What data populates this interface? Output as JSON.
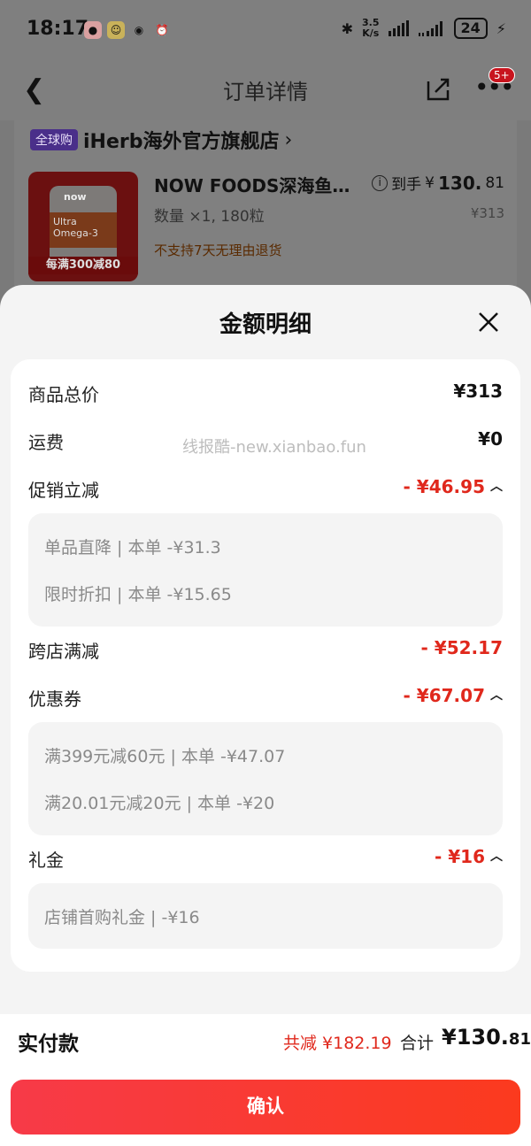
{
  "status_bar": {
    "time": "18:17",
    "net_speed_value": "3.5",
    "net_speed_unit": "K/s",
    "battery": "24"
  },
  "nav": {
    "title": "订单详情",
    "badge": "5+"
  },
  "order": {
    "global_tag": "全球购",
    "store_name": "iHerb海外官方旗舰店",
    "product_name": "NOW FOODS深海鱼…",
    "quantity": "数量 ×1, 180粒",
    "policy": "不支持7天无理由退货",
    "final_price_label": "到手",
    "final_price_currency": "¥",
    "final_price_int": "130.",
    "final_price_dec": "81",
    "original_price": "¥313",
    "image_promo": "每满300减80",
    "image_brand": "now",
    "image_text": "Ultra Omega-3"
  },
  "sheet": {
    "title": "金额明细",
    "rows": {
      "goods_total": {
        "label": "商品总价",
        "value": "¥313"
      },
      "shipping": {
        "label": "运费",
        "value": "¥0"
      },
      "promotion": {
        "label": "促销立减",
        "value": "- ¥46.95"
      },
      "promotion_details": [
        "单品直降 | 本单 -¥31.3",
        "限时折扣 | 本单 -¥15.65"
      ],
      "cross_store": {
        "label": "跨店满减",
        "value": "- ¥52.17"
      },
      "coupon": {
        "label": "优惠券",
        "value": "- ¥67.07"
      },
      "coupon_details": [
        "满399元减60元 | 本单 -¥47.07",
        "满20.01元减20元 | 本单 -¥20"
      ],
      "gift_money": {
        "label": "礼金",
        "value": "- ¥16"
      },
      "gift_details": [
        "店铺首购礼金 | -¥16"
      ]
    },
    "watermark": "线报酷-new.xianbao.fun"
  },
  "summary": {
    "label": "实付款",
    "total_reduce": "共减 ¥182.19",
    "total_label": "合计",
    "total_int": "¥130.",
    "total_dec": "81"
  },
  "footer": {
    "confirm_label": "确认"
  },
  "colors": {
    "accent_red": "#e0281c",
    "button_gradient_start": "#f73a48",
    "button_gradient_end": "#fb3a1e",
    "global_tag": "#4a2f8a"
  }
}
